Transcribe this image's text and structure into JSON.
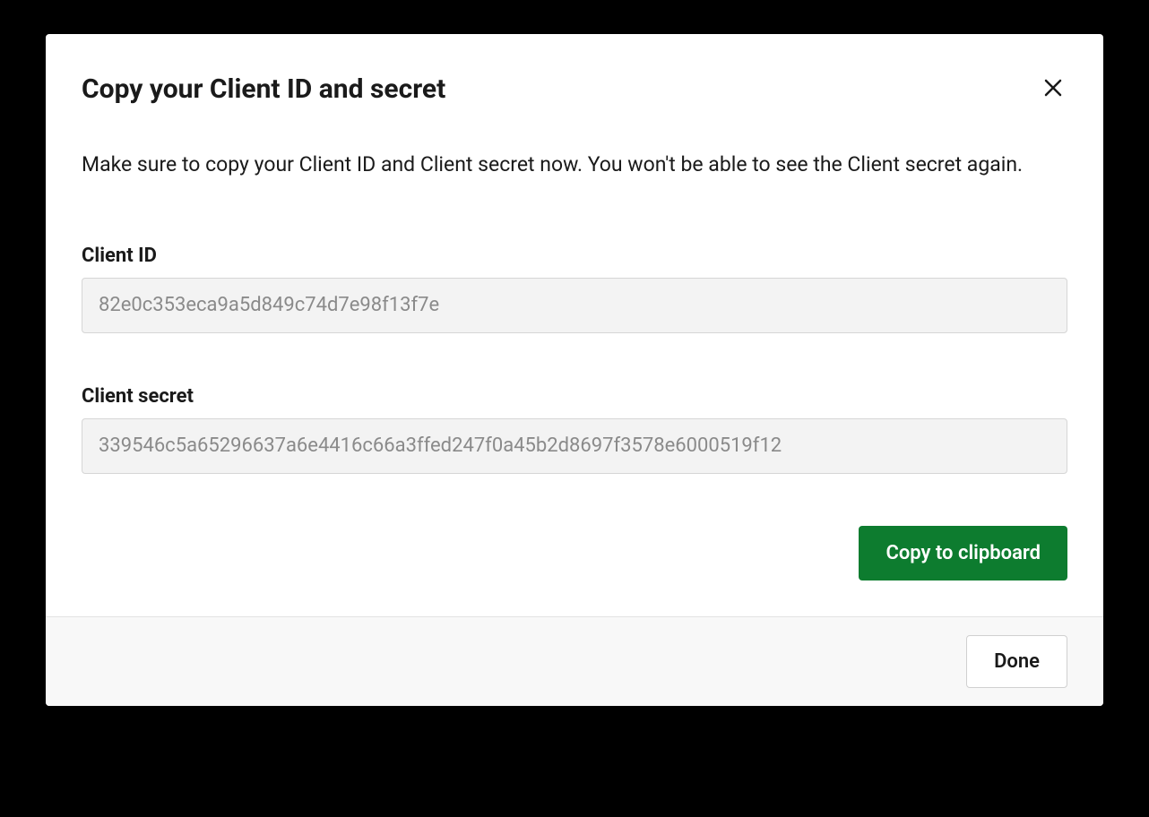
{
  "modal": {
    "title": "Copy your Client ID and secret",
    "description": "Make sure to copy your Client ID and Client secret now. You won't be able to see the Client secret again.",
    "fields": {
      "clientId": {
        "label": "Client ID",
        "value": "82e0c353eca9a5d849c74d7e98f13f7e"
      },
      "clientSecret": {
        "label": "Client secret",
        "value": "339546c5a65296637a6e4416c66a3ffed247f0a45b2d8697f3578e6000519f12"
      }
    },
    "actions": {
      "copyToClipboard": "Copy to clipboard",
      "done": "Done"
    }
  }
}
